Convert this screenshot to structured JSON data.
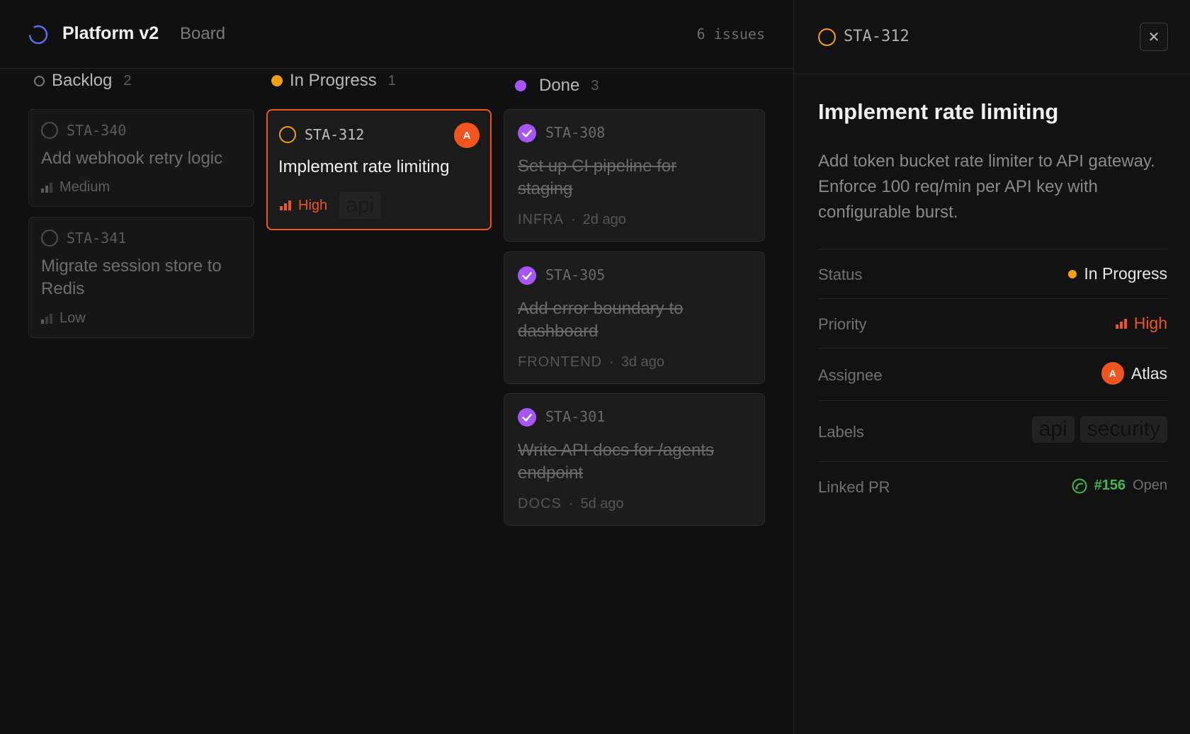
{
  "header": {
    "project_name": "Platform v2",
    "view_name": "Board",
    "issue_count": "6 issues"
  },
  "columns": [
    {
      "title": "Backlog",
      "count": "2",
      "cards": [
        {
          "id": "STA-340",
          "title": "Add webhook retry logic",
          "priority": "Medium"
        },
        {
          "id": "STA-341",
          "title_line1": "Migrate session store to",
          "title_line2": "Redis",
          "priority": "Low"
        }
      ]
    },
    {
      "title": "In Progress",
      "count": "1",
      "cards": [
        {
          "id": "STA-312",
          "title": "Implement rate limiting",
          "priority": "High",
          "label": "api",
          "avatar": "A"
        }
      ]
    },
    {
      "title": "Done",
      "count": "3",
      "cards": [
        {
          "id": "STA-308",
          "title_line1": "Set up CI pipeline for",
          "title_line2": "staging",
          "tag": "INFRA",
          "sep": "·",
          "age": "2d ago"
        },
        {
          "id": "STA-305",
          "title_line1": "Add error boundary to",
          "title_line2": "dashboard",
          "tag": "FRONTEND",
          "sep": "·",
          "age": "3d ago"
        },
        {
          "id": "STA-301",
          "title_line1": "Write API docs for /agents",
          "title_line2": "endpoint",
          "tag": "DOCS",
          "sep": "·",
          "age": "5d ago"
        }
      ]
    }
  ],
  "panel": {
    "issue_id": "STA-312",
    "close_label": "✕",
    "title": "Implement rate limiting",
    "description": "Add token bucket rate limiter to API gateway. Enforce 100 req/min per API key with configurable burst.",
    "properties": {
      "status_label": "Status",
      "status_value": "In Progress",
      "priority_label": "Priority",
      "priority_value": "High",
      "assignee_label": "Assignee",
      "assignee_avatar": "A",
      "assignee_name": "Atlas",
      "labels_label": "Labels",
      "labels": [
        "api",
        "security"
      ],
      "pr_label": "Linked PR",
      "pr_number": "#156",
      "pr_state": "Open"
    }
  },
  "colors": {
    "accent_orange": "#f0541f",
    "in_progress_yellow": "#f29f0f",
    "done_purple": "#a855f7",
    "project_blue": "#5b6ee1",
    "pr_green": "#3fb950"
  }
}
